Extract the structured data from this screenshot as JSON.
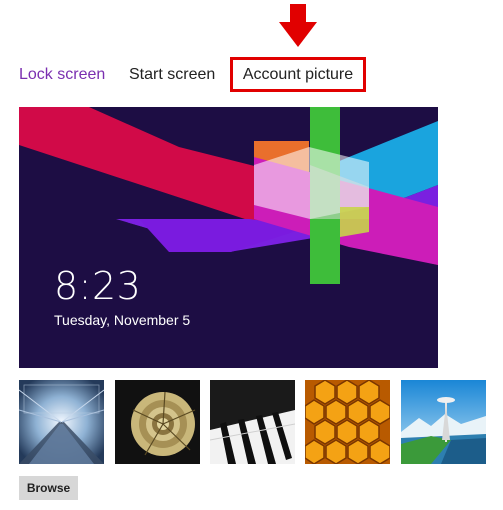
{
  "tabs": {
    "lock_screen": "Lock screen",
    "start_screen": "Start screen",
    "account_picture": "Account picture"
  },
  "preview": {
    "time": "8:23",
    "date": "Tuesday, November 5"
  },
  "thumbnails": [
    {
      "name": "tunnel-thumbnail"
    },
    {
      "name": "nautilus-thumbnail"
    },
    {
      "name": "piano-keys-thumbnail"
    },
    {
      "name": "honeycomb-thumbnail"
    },
    {
      "name": "space-needle-thumbnail"
    }
  ],
  "browse_label": "Browse",
  "colors": {
    "accent_tab": "#7a2fb0",
    "highlight_border": "#e10000",
    "preview_bg": "#1d0d44",
    "button_bg": "#d7d7d7"
  }
}
